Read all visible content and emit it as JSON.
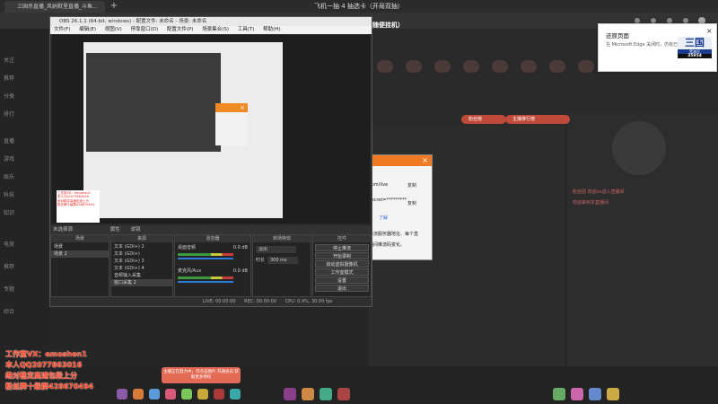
{
  "browser": {
    "tab_title": "三国杀直播_风纳默里直播_斗鱼...",
    "new_tab_symbol": "+",
    "notification_title": "还原页面",
    "notification_body": "在 Microsoft Edge 关闭时，仍有已打开的页面",
    "close_symbol": "×"
  },
  "stream": {
    "top_heading": "飞机一抽 4 抽选卡（开局双抽）",
    "sub_heading": "看叭不看不骂鼓励（随便挂机）",
    "nav": [
      "关注",
      "推荐",
      "分类",
      "排行",
      "直播",
      "游戏",
      "娱乐",
      "科技",
      "知识",
      "电竞",
      "推荐",
      "专题",
      "综合"
    ],
    "badges": [
      "主播排行榜",
      "粉丝榜"
    ],
    "chat_line_1": "粉丝团 欢迎xx进入直播间",
    "chat_line_2": "欢迎来到本直播间"
  },
  "obs": {
    "title": "OBS 26.1.1 (64-bit, windows) - 配置文件: 未命名 - 场景: 未命名",
    "menu": [
      "文件(F)",
      "编辑(E)",
      "视图(V)",
      "停靠窗口(D)",
      "配置文件(P)",
      "场景集合(S)",
      "工具(T)",
      "帮助(H)"
    ],
    "preview_mode": "未选择源",
    "tabs": [
      "属性",
      "滤镜"
    ],
    "scenes_header": "场景",
    "scenes": [
      "场景",
      "场景 2"
    ],
    "sources_header": "来源",
    "sources": [
      "文本 (GDI+) 2",
      "文本 (GDI+)",
      "文本 (GDI+) 3",
      "文本 (GDI+) 4",
      "音频输入采集",
      "窗口采集 2"
    ],
    "mixer_header": "混音器",
    "mixer_channels": [
      {
        "name": "桌面音频",
        "db": "0.0 dB"
      },
      {
        "name": "麦克风/Aux",
        "db": "0.0 dB"
      }
    ],
    "transition_header": "转场特效",
    "transition_type": "淡出",
    "transition_duration_label": "时长",
    "transition_duration": "300 ms",
    "controls_header": "控件",
    "controls": [
      "停止推流",
      "开始录制",
      "启动虚拟摄像机",
      "工作室模式",
      "设置",
      "退出"
    ],
    "status": {
      "live": "LIVE: 00:00:00",
      "rec": "REC: 00:00:00",
      "cpu": "CPU: 0.9%, 30.00 fps"
    }
  },
  "dialog": {
    "close_symbol": "×",
    "line1": "com/live",
    "copy1": "复制",
    "line2": "secret=*********",
    "copy2": "复制",
    "link": "了解",
    "note1": "推流服务器地址、每个直",
    "note2": "播间推流码变化。"
  },
  "counter": {
    "title": "三国",
    "subtitle": "黑海号",
    "number": "35954"
  },
  "promo": {
    "lines": [
      "工作室VX：emoshen1",
      "本人QQ2077863016",
      "绝对稳定高速包段上分",
      "粉丝牌十级群428670494"
    ]
  },
  "banner_text": "主播正在努力中，可点击图片 开通会员 获取更多特权"
}
